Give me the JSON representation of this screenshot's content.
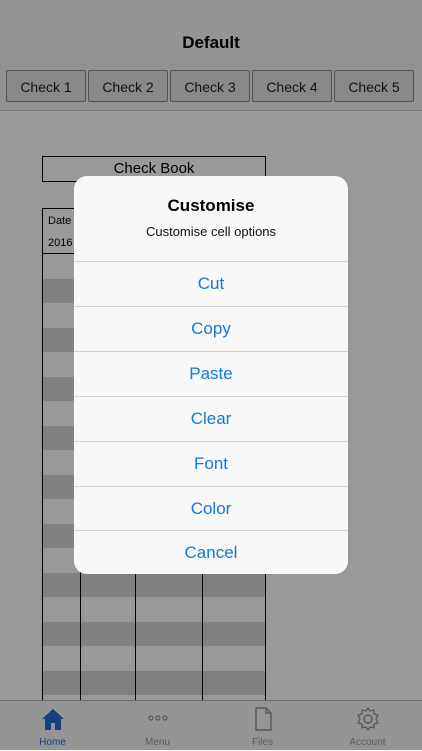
{
  "navbar": {
    "title": "Default"
  },
  "tabs": [
    {
      "label": "Check 1"
    },
    {
      "label": "Check 2"
    },
    {
      "label": "Check 3"
    },
    {
      "label": "Check 4"
    },
    {
      "label": "Check 5"
    }
  ],
  "sheet": {
    "title": "Check Book",
    "header_cell": "Date",
    "first_value": "2016"
  },
  "alert": {
    "title": "Customise",
    "message": "Customise cell options",
    "actions": [
      {
        "label": "Cut"
      },
      {
        "label": "Copy"
      },
      {
        "label": "Paste"
      },
      {
        "label": "Clear"
      },
      {
        "label": "Font"
      },
      {
        "label": "Color"
      },
      {
        "label": "Cancel"
      }
    ]
  },
  "tabbar": {
    "items": [
      {
        "label": "Home",
        "icon": "home-icon",
        "active": true
      },
      {
        "label": "Menu",
        "icon": "more-icon",
        "active": false
      },
      {
        "label": "Files",
        "icon": "file-icon",
        "active": false
      },
      {
        "label": "Account",
        "icon": "gear-icon",
        "active": false
      }
    ]
  },
  "colors": {
    "accent": "#1479d4",
    "tab_active": "#1f6bd8"
  }
}
